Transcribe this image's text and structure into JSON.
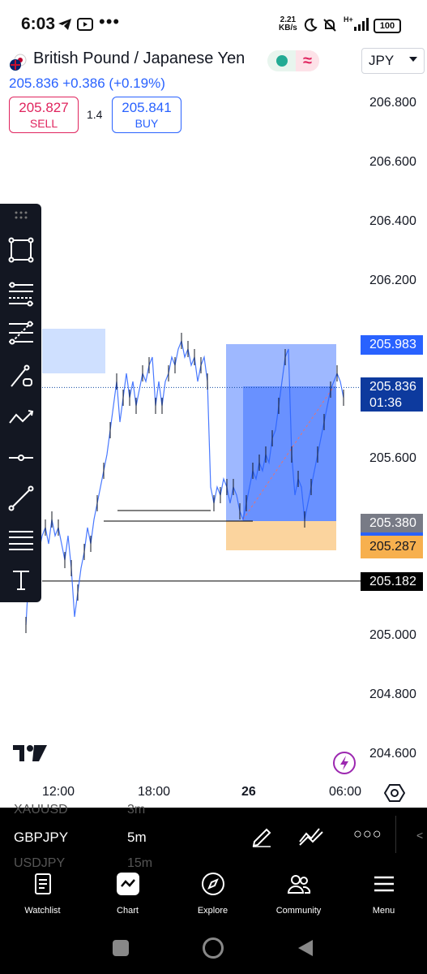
{
  "status_bar": {
    "time": "6:03",
    "net_speed_value": "2.21",
    "net_speed_unit": "KB/s",
    "signal_label": "H+",
    "battery": "100"
  },
  "header": {
    "title": "British Pound / Japanese Yen",
    "status_wave": "≈",
    "currency": "JPY",
    "last_price": "205.836",
    "change": "+0.386",
    "change_percent": "(+0.19%)",
    "sell_price": "205.827",
    "sell_label": "SELL",
    "spread": "1.4",
    "buy_price": "205.841",
    "buy_label": "BUY"
  },
  "chart": {
    "price_ticks": [
      "206.800",
      "206.600",
      "206.400",
      "206.200",
      "205.600",
      "205.000",
      "204.800",
      "204.600"
    ],
    "tags": {
      "target": "205.983",
      "current": "205.836",
      "countdown": "01:36",
      "entry": "205.380",
      "stop": "205.287",
      "line": "205.182"
    },
    "time_ticks": [
      "12:00",
      "18:00",
      "26",
      "06:00"
    ],
    "colors": {
      "up": "#2962ff",
      "target_zone": "#2962ff",
      "stop_zone": "#f7b04e",
      "current_tag": "#0d47a1",
      "line_tag": "#000000"
    }
  },
  "chart_data": {
    "type": "line",
    "title": "",
    "xlabel": "",
    "ylabel": "",
    "x": [
      "12:00",
      "18:00",
      "26",
      "06:00"
    ],
    "ylim": [
      204.55,
      206.85
    ],
    "series": [],
    "annotations": [
      {
        "label": "205.983",
        "value": 205.983
      },
      {
        "label": "205.836",
        "value": 205.836
      },
      {
        "label": "205.380",
        "value": 205.38
      },
      {
        "label": "205.287",
        "value": 205.287
      },
      {
        "label": "205.182",
        "value": 205.182
      }
    ]
  },
  "symbols": {
    "prev": "XAUUSD",
    "prev_interval": "3m",
    "current": "GBPJPY",
    "current_interval": "5m",
    "next": "USDJPY",
    "next_interval": "15m"
  },
  "nav": {
    "items": [
      {
        "label": "Watchlist"
      },
      {
        "label": "Chart"
      },
      {
        "label": "Explore"
      },
      {
        "label": "Community"
      },
      {
        "label": "Menu"
      }
    ]
  }
}
